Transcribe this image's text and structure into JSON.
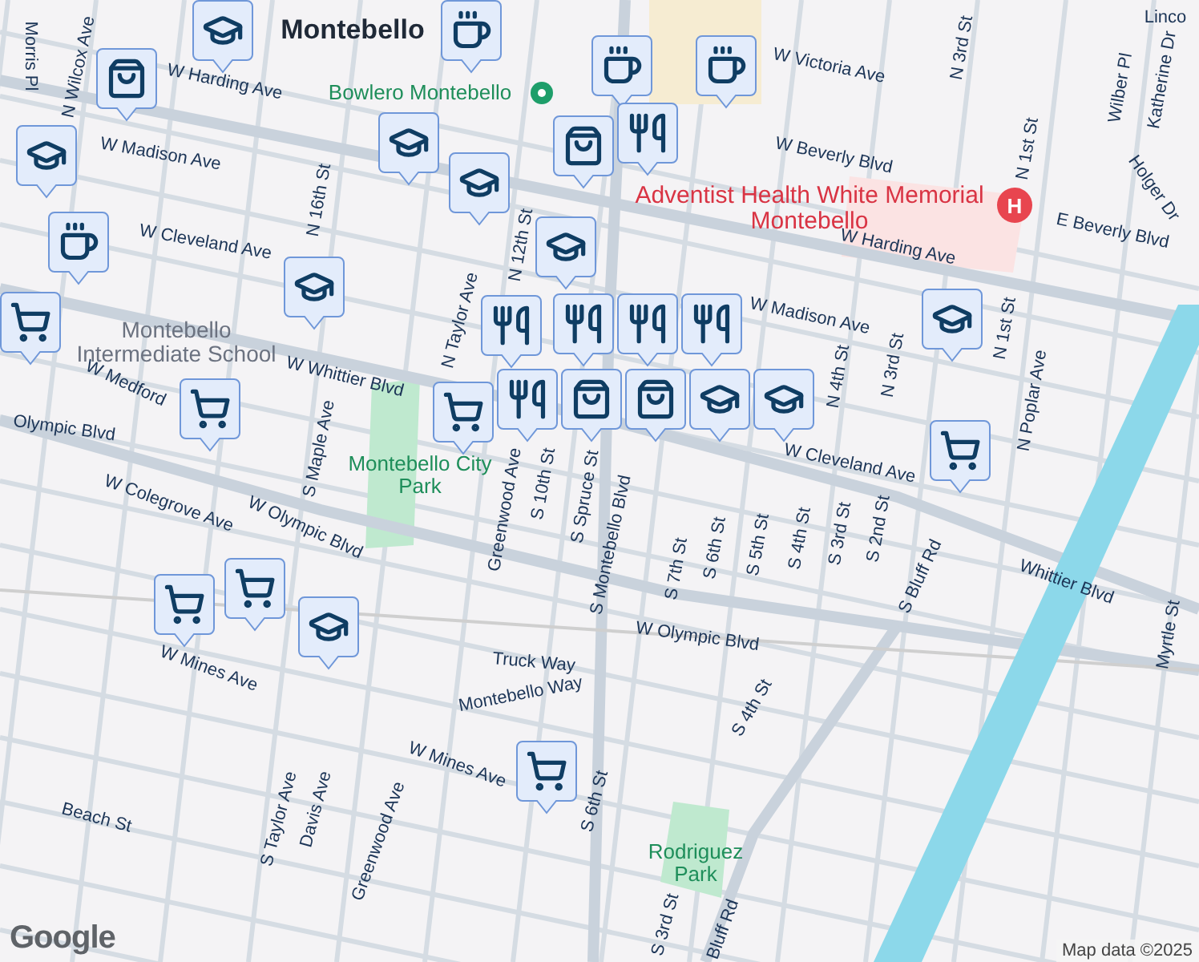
{
  "map": {
    "labels": [
      {
        "kind": "place",
        "text": "Montebello"
      },
      {
        "kind": "park",
        "text": "Bowlero Montebello"
      },
      {
        "kind": "hospital",
        "text": "Adventist Health White Memorial Montebello"
      },
      {
        "kind": "school",
        "text": "Montebello Intermediate School"
      },
      {
        "kind": "park",
        "text": "Montebello City Park"
      },
      {
        "kind": "park",
        "text": "Rodriguez Park"
      },
      {
        "kind": "street",
        "text": "Morris Pl"
      },
      {
        "kind": "street",
        "text": "N Wilcox Ave"
      },
      {
        "kind": "street",
        "text": "W Harding Ave"
      },
      {
        "kind": "street",
        "text": "W Madison Ave"
      },
      {
        "kind": "street",
        "text": "W Cleveland Ave"
      },
      {
        "kind": "street",
        "text": "N 16th St"
      },
      {
        "kind": "street",
        "text": "N 12th St"
      },
      {
        "kind": "street",
        "text": "N Taylor Ave"
      },
      {
        "kind": "street",
        "text": "W Whittier Blvd"
      },
      {
        "kind": "street",
        "text": "W Medford"
      },
      {
        "kind": "street",
        "text": "Olympic Blvd"
      },
      {
        "kind": "street",
        "text": "S Maple Ave"
      },
      {
        "kind": "street",
        "text": "Greenwood Ave"
      },
      {
        "kind": "street",
        "text": "S 10th St"
      },
      {
        "kind": "street",
        "text": "S Spruce St"
      },
      {
        "kind": "street",
        "text": "W Colegrove Ave"
      },
      {
        "kind": "street",
        "text": "W Olympic Blvd"
      },
      {
        "kind": "street",
        "text": "W Victoria Ave"
      },
      {
        "kind": "street",
        "text": "W Beverly Blvd"
      },
      {
        "kind": "street",
        "text": "E Beverly Blvd"
      },
      {
        "kind": "street",
        "text": "W Harding Ave"
      },
      {
        "kind": "street",
        "text": "W Madison Ave"
      },
      {
        "kind": "street",
        "text": "W Cleveland Ave"
      },
      {
        "kind": "street",
        "text": "N 3rd St"
      },
      {
        "kind": "street",
        "text": "N 1st St"
      },
      {
        "kind": "street",
        "text": "N 1st St"
      },
      {
        "kind": "street",
        "text": "N Poplar Ave"
      },
      {
        "kind": "street",
        "text": "N 4th St"
      },
      {
        "kind": "street",
        "text": "N 3rd St"
      },
      {
        "kind": "street",
        "text": "Wilber Pl"
      },
      {
        "kind": "street",
        "text": "Katherine Dr"
      },
      {
        "kind": "street",
        "text": "Holger Dr"
      },
      {
        "kind": "street",
        "text": "Linco"
      },
      {
        "kind": "street",
        "text": "W Olympic Blvd"
      },
      {
        "kind": "street",
        "text": "Whittier Blvd"
      },
      {
        "kind": "street",
        "text": "S Bluff Rd"
      },
      {
        "kind": "street",
        "text": "S 7th St"
      },
      {
        "kind": "street",
        "text": "S 6th St"
      },
      {
        "kind": "street",
        "text": "S 5th St"
      },
      {
        "kind": "street",
        "text": "S 4th St"
      },
      {
        "kind": "street",
        "text": "S 3rd St"
      },
      {
        "kind": "street",
        "text": "S 2nd St"
      },
      {
        "kind": "street",
        "text": "S Montebello Blvd"
      },
      {
        "kind": "street",
        "text": "Truck Way"
      },
      {
        "kind": "street",
        "text": "Montebello Way"
      },
      {
        "kind": "street",
        "text": "W Mines Ave"
      },
      {
        "kind": "street",
        "text": "W Mines Ave"
      },
      {
        "kind": "street",
        "text": "S Taylor Ave"
      },
      {
        "kind": "street",
        "text": "Davis Ave"
      },
      {
        "kind": "street",
        "text": "Greenwood Ave"
      },
      {
        "kind": "street",
        "text": "Beach St"
      },
      {
        "kind": "street",
        "text": "S 4th St"
      },
      {
        "kind": "street",
        "text": "S 6th St"
      },
      {
        "kind": "street",
        "text": "S 3rd St"
      },
      {
        "kind": "street",
        "text": "Bluff Rd"
      },
      {
        "kind": "street",
        "text": "Myrtle St"
      }
    ],
    "hospital_marker": {
      "letter": "H"
    },
    "pins": [
      {
        "kind": "school"
      },
      {
        "kind": "cafe"
      },
      {
        "kind": "cafe"
      },
      {
        "kind": "cafe"
      },
      {
        "kind": "school"
      },
      {
        "kind": "school"
      },
      {
        "kind": "school"
      },
      {
        "kind": "cafe"
      },
      {
        "kind": "cart"
      },
      {
        "kind": "school"
      },
      {
        "kind": "school"
      },
      {
        "kind": "school"
      },
      {
        "kind": "restaurant"
      },
      {
        "kind": "restaurant"
      },
      {
        "kind": "restaurant"
      },
      {
        "kind": "cart"
      },
      {
        "kind": "cart"
      },
      {
        "kind": "restaurant"
      },
      {
        "kind": "bag"
      },
      {
        "kind": "bag"
      },
      {
        "kind": "school"
      },
      {
        "kind": "school"
      },
      {
        "kind": "cart"
      },
      {
        "kind": "cart"
      },
      {
        "kind": "cart"
      },
      {
        "kind": "school"
      },
      {
        "kind": "cart"
      },
      {
        "kind": "bag"
      },
      {
        "kind": "restaurant"
      },
      {
        "kind": "restaurant"
      },
      {
        "kind": "bag"
      }
    ],
    "attribution": "Map data ©2025",
    "logo": "Google"
  }
}
